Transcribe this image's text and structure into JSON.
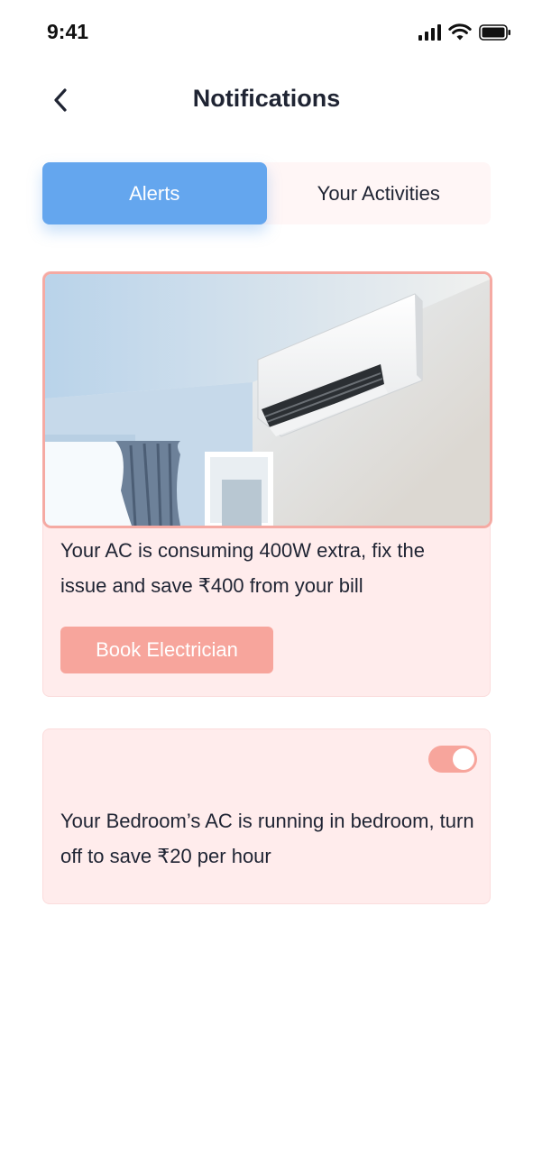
{
  "status_bar": {
    "time": "9:41",
    "icons": [
      "signal-icon",
      "wifi-icon",
      "battery-icon"
    ]
  },
  "header": {
    "title": "Notifications",
    "back_icon": "chevron-left-icon"
  },
  "tabs": [
    {
      "label": "Alerts",
      "active": true
    },
    {
      "label": "Your Activities",
      "active": false
    }
  ],
  "alerts": [
    {
      "image": "air-conditioner-photo",
      "text": "Your AC is consuming 400W extra, fix the issue and save ₹400 from your bill",
      "button_label": "Book Electrician"
    },
    {
      "toggle_on": true,
      "text": "Your Bedroom’s AC is running in bedroom, turn off to save ₹20 per hour"
    }
  ],
  "colors": {
    "accent": "#64a6ee",
    "card_bg": "#ffecec",
    "button": "#f7a59c",
    "text": "#1f2433"
  }
}
